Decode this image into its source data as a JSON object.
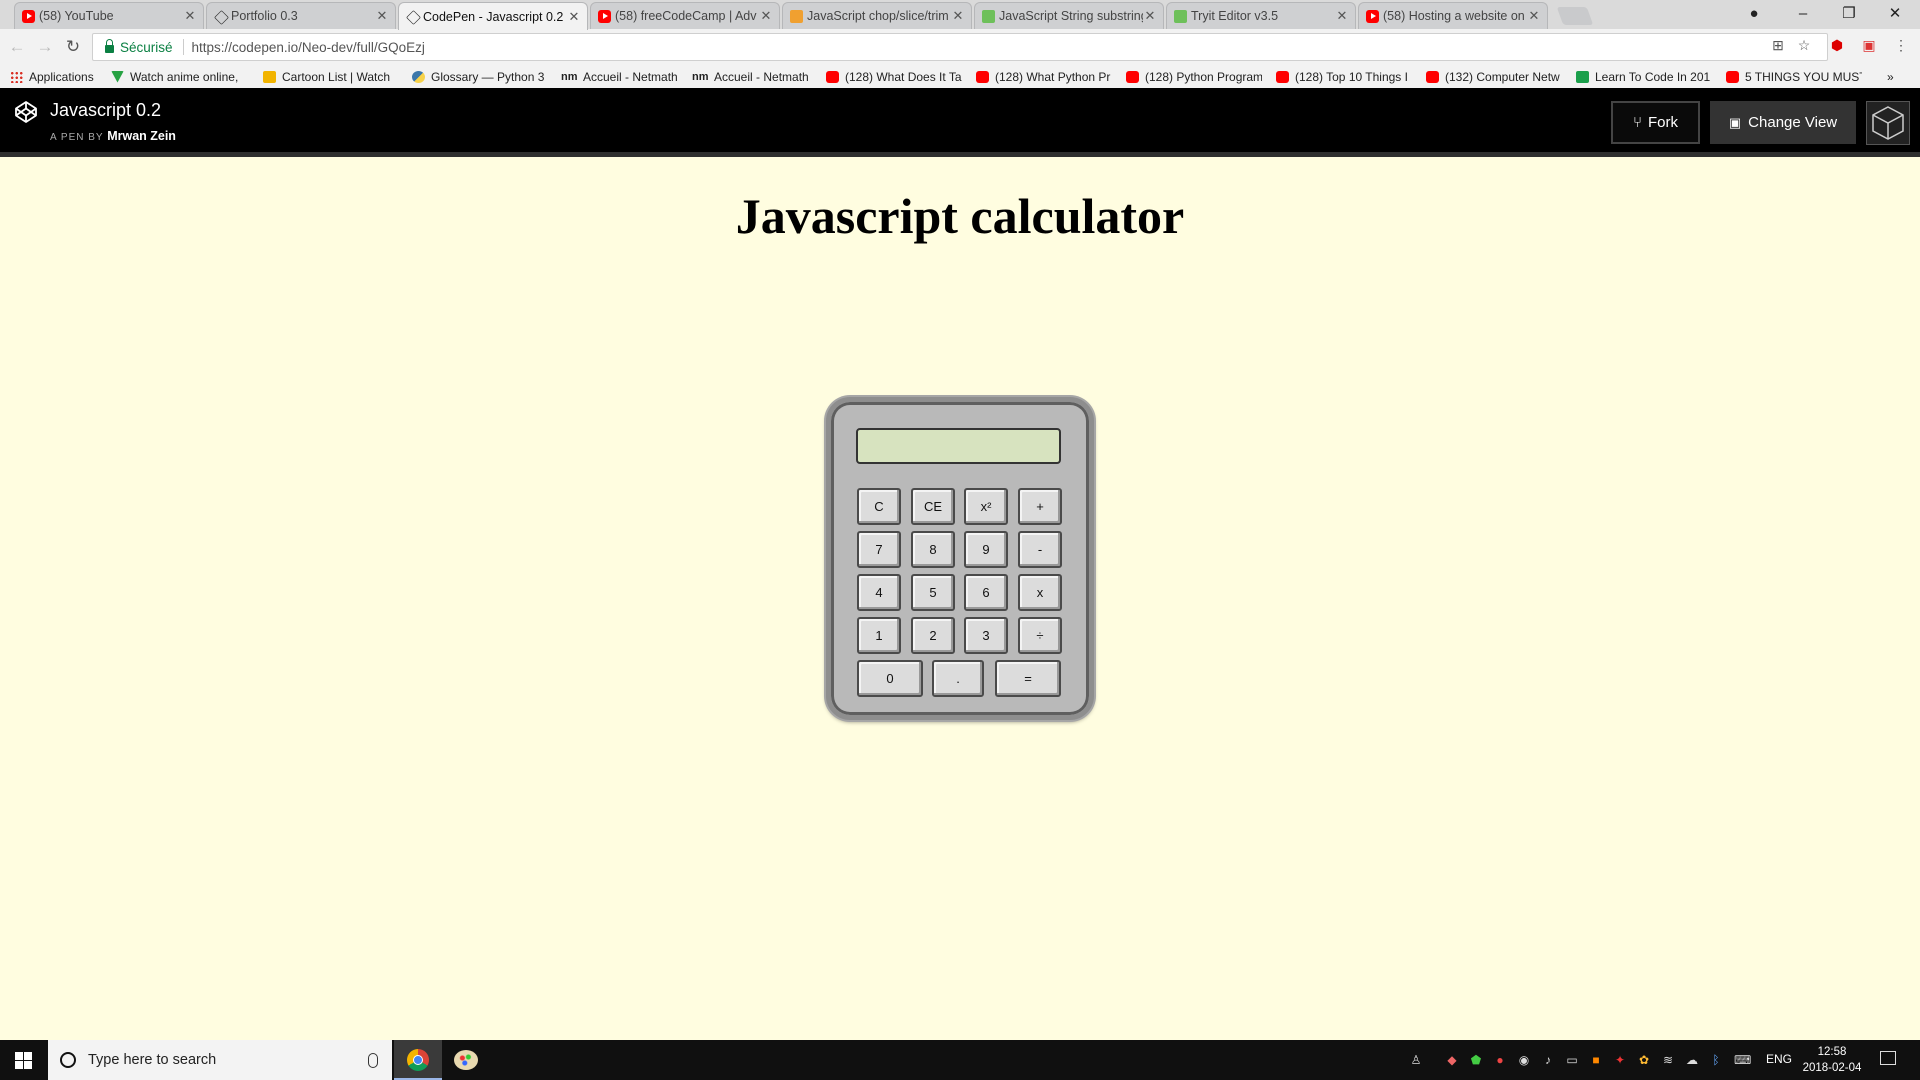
{
  "browser": {
    "tabs": [
      {
        "title": "(58) YouTube",
        "favicon": "youtube-icon",
        "active": false
      },
      {
        "title": "Portfolio 0.3",
        "favicon": "codepen-icon",
        "active": false
      },
      {
        "title": "CodePen - Javascript 0.2",
        "favicon": "codepen-icon",
        "active": true
      },
      {
        "title": "(58) freeCodeCamp | Adv",
        "favicon": "youtube-icon",
        "active": false
      },
      {
        "title": "JavaScript chop/slice/trim",
        "favicon": "stackoverflow-icon",
        "active": false
      },
      {
        "title": "JavaScript String substring",
        "favicon": "w3schools-icon",
        "active": false
      },
      {
        "title": "Tryit Editor v3.5",
        "favicon": "w3schools-icon",
        "active": false
      },
      {
        "title": "(58) Hosting a website on",
        "favicon": "youtube-icon",
        "active": false
      }
    ],
    "secure_label": "Sécurisé",
    "url": "https://codepen.io/Neo-dev/full/GQoEzj",
    "bookmarks": [
      {
        "label": "Applications",
        "icon": "apps-grid-icon"
      },
      {
        "label": "Watch anime online,",
        "icon": "anime-icon"
      },
      {
        "label": "Cartoon List | Watch",
        "icon": "cartoon-icon"
      },
      {
        "label": "Glossary — Python 3",
        "icon": "python-icon"
      },
      {
        "label": "Accueil - Netmath",
        "icon": "netmath-icon"
      },
      {
        "label": "Accueil - Netmath",
        "icon": "netmath-icon"
      },
      {
        "label": "(128) What Does It Ta",
        "icon": "youtube-icon"
      },
      {
        "label": "(128) What Python Pr",
        "icon": "youtube-icon"
      },
      {
        "label": "(128) Python Program",
        "icon": "youtube-icon"
      },
      {
        "label": "(128) Top 10 Things I",
        "icon": "youtube-icon"
      },
      {
        "label": "(132) Computer Netw",
        "icon": "youtube-icon"
      },
      {
        "label": "Learn To Code In 201",
        "icon": "learn-code-icon"
      },
      {
        "label": "5 THINGS YOU MUST",
        "icon": "youtube-icon"
      }
    ],
    "bookmarks_more": "»"
  },
  "codepen": {
    "pen_title": "Javascript 0.2",
    "by_label": "A PEN BY",
    "author": "Mrwan Zein",
    "fork_label": "Fork",
    "change_view_label": "Change View"
  },
  "page": {
    "title": "Javascript calculator",
    "display_value": "",
    "keys": [
      {
        "label": "C",
        "name": "clear"
      },
      {
        "label": "CE",
        "name": "clear-entry"
      },
      {
        "label": "x²",
        "name": "square"
      },
      {
        "label": "+",
        "name": "plus"
      },
      {
        "label": "7",
        "name": "7"
      },
      {
        "label": "8",
        "name": "8"
      },
      {
        "label": "9",
        "name": "9"
      },
      {
        "label": "-",
        "name": "minus"
      },
      {
        "label": "4",
        "name": "4"
      },
      {
        "label": "5",
        "name": "5"
      },
      {
        "label": "6",
        "name": "6"
      },
      {
        "label": "x",
        "name": "multiply"
      },
      {
        "label": "1",
        "name": "1"
      },
      {
        "label": "2",
        "name": "2"
      },
      {
        "label": "3",
        "name": "3"
      },
      {
        "label": "÷",
        "name": "divide"
      },
      {
        "label": "0",
        "name": "0"
      },
      {
        "label": ".",
        "name": "decimal"
      },
      {
        "label": "=",
        "name": "equals"
      }
    ]
  },
  "taskbar": {
    "search_placeholder": "Type here to search",
    "language": "ENG",
    "time": "12:58",
    "date": "2018-02-04"
  }
}
